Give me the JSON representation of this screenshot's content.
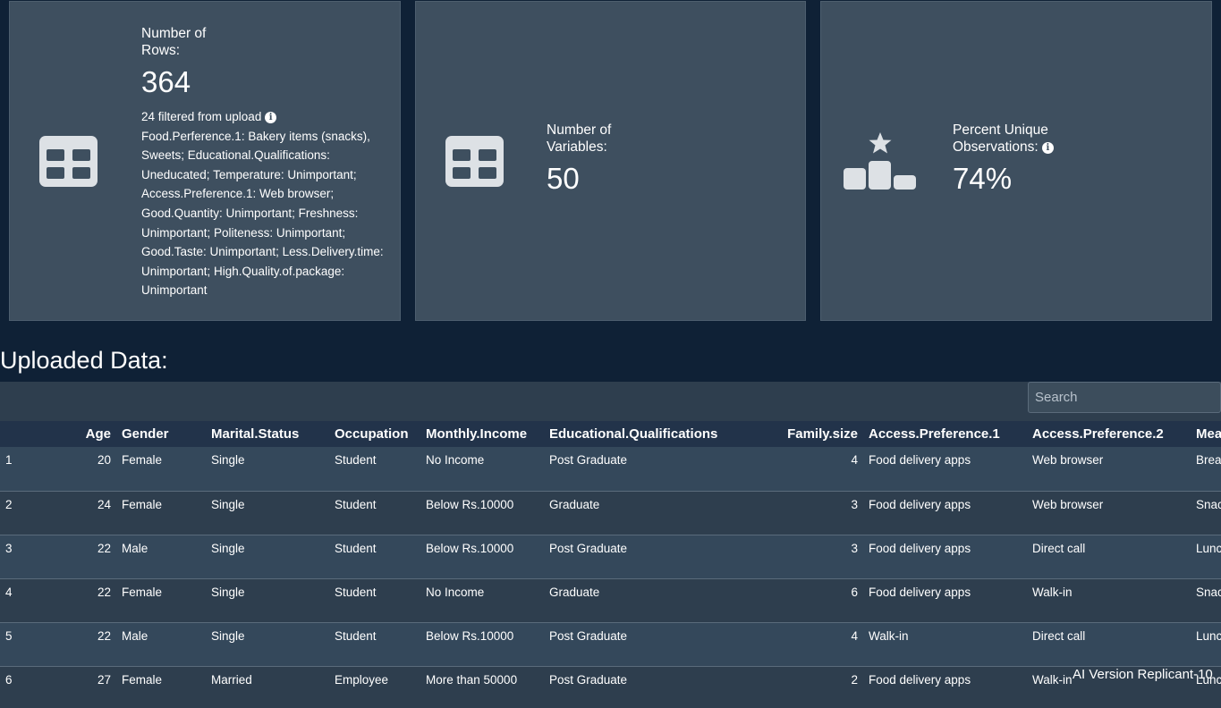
{
  "cards": {
    "rows": {
      "label": "Number of Rows:",
      "value": "364",
      "filter_note": "24 filtered from upload",
      "filter_detail": "Food.Perference.1: Bakery items (snacks), Sweets; Educational.Qualifications: Uneducated; Temperature: Unimportant; Access.Preference.1: Web browser; Good.Quantity: Unimportant; Freshness: Unimportant; Politeness: Unimportant; Good.Taste: Unimportant; Less.Delivery.time: Unimportant; High.Quality.of.package: Unimportant",
      "icon": "table-icon"
    },
    "variables": {
      "label": "Number of Variables:",
      "value": "50",
      "icon": "table-icon"
    },
    "unique": {
      "label": "Percent Unique Observations:",
      "value": "74%",
      "icon": "podium-icon"
    }
  },
  "section_title": "Uploaded Data:",
  "search": {
    "placeholder": "Search"
  },
  "table": {
    "headers": [
      "",
      "Age",
      "Gender",
      "Marital.Status",
      "Occupation",
      "Monthly.Income",
      "Educational.Qualifications",
      "Family.size",
      "Access.Preference.1",
      "Access.Preference.2",
      "Mea"
    ],
    "rows": [
      [
        "1",
        "20",
        "Female",
        "Single",
        "Student",
        "No Income",
        "Post Graduate",
        "4",
        "Food delivery apps",
        "Web browser",
        "Brea"
      ],
      [
        "2",
        "24",
        "Female",
        "Single",
        "Student",
        "Below Rs.10000",
        "Graduate",
        "3",
        "Food delivery apps",
        "Web browser",
        "Snac"
      ],
      [
        "3",
        "22",
        "Male",
        "Single",
        "Student",
        "Below Rs.10000",
        "Post Graduate",
        "3",
        "Food delivery apps",
        "Direct call",
        "Lunc"
      ],
      [
        "4",
        "22",
        "Female",
        "Single",
        "Student",
        "No Income",
        "Graduate",
        "6",
        "Food delivery apps",
        "Walk-in",
        "Snac"
      ],
      [
        "5",
        "22",
        "Male",
        "Single",
        "Student",
        "Below Rs.10000",
        "Post Graduate",
        "4",
        "Walk-in",
        "Direct call",
        "Lunc"
      ],
      [
        "6",
        "27",
        "Female",
        "Married",
        "Employee",
        "More than 50000",
        "Post Graduate",
        "2",
        "Food delivery apps",
        "Walk-in",
        "Lunc"
      ]
    ]
  },
  "watermark": "AI Version Replicant-10"
}
